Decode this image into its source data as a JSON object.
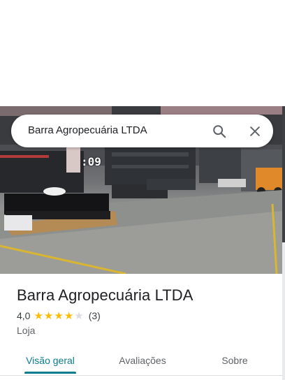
{
  "search": {
    "query": "Barra Agropecuária LTDA"
  },
  "photo": {
    "overlay_text": ":09"
  },
  "place": {
    "title": "Barra Agropecuária LTDA",
    "rating_value": "4,0",
    "rating_stars": 4,
    "rating_max": 5,
    "review_count": "(3)",
    "category": "Loja"
  },
  "tabs": [
    {
      "label": "Visão geral",
      "active": true
    },
    {
      "label": "Avaliações",
      "active": false
    },
    {
      "label": "Sobre",
      "active": false
    }
  ],
  "colors": {
    "accent": "#0b7d8c",
    "star": "#fbbc04",
    "star_empty": "#dadce0"
  }
}
